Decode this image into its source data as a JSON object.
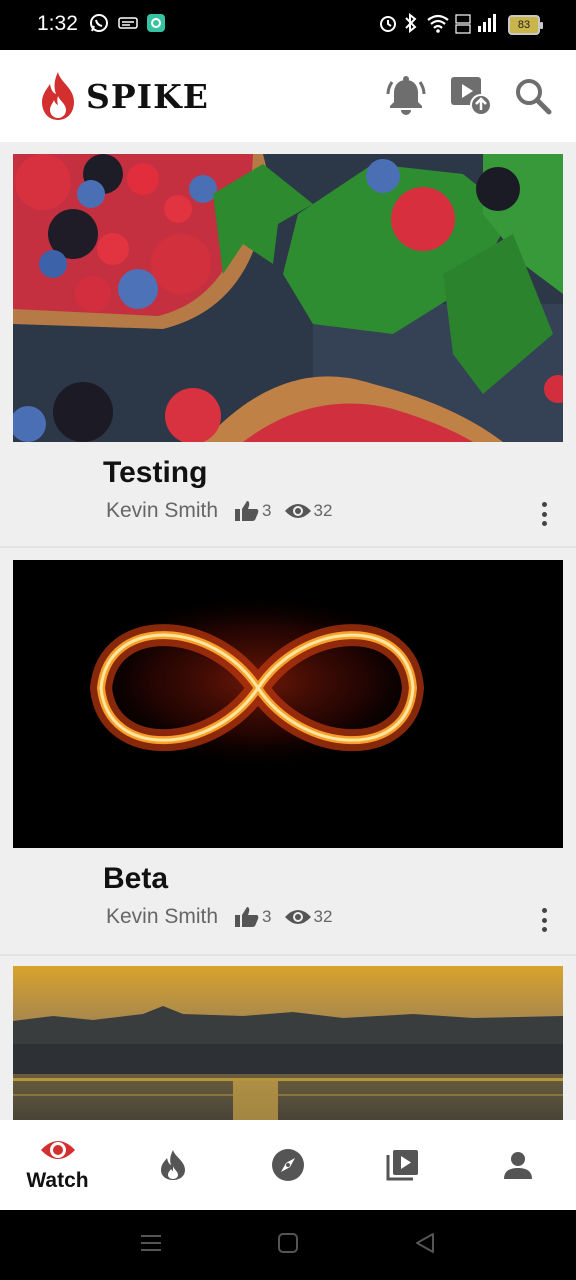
{
  "status_bar": {
    "time": "1:32",
    "battery": "83"
  },
  "app": {
    "brand": "SPIKE",
    "brand_color": "#d32f2f"
  },
  "feed": {
    "videos": [
      {
        "title": "Testing",
        "author": "Kevin Smith",
        "likes": "3",
        "views": "32",
        "thumbnail": "berries-on-dark-table"
      },
      {
        "title": "Beta",
        "author": "Kevin Smith",
        "likes": "3",
        "views": "32",
        "thumbnail": "glowing-infinity-symbol"
      },
      {
        "title": "",
        "author": "",
        "likes": "",
        "views": "",
        "thumbnail": "sunset-over-water"
      }
    ]
  },
  "bottom_nav": {
    "items": [
      {
        "id": "watch",
        "label": "Watch",
        "icon": "eye-icon",
        "active": true
      },
      {
        "id": "trending",
        "label": "",
        "icon": "flame-icon",
        "active": false
      },
      {
        "id": "explore",
        "label": "",
        "icon": "compass-icon",
        "active": false
      },
      {
        "id": "library",
        "label": "",
        "icon": "video-library-icon",
        "active": false
      },
      {
        "id": "profile",
        "label": "",
        "icon": "person-icon",
        "active": false
      }
    ],
    "active_color": "#d32f2f",
    "inactive_color": "#555555"
  },
  "icons": {
    "notifications": "bell-icon",
    "upload": "upload-video-icon",
    "search": "search-icon",
    "like": "thumbs-up-icon",
    "views": "eye-icon",
    "more": "more-vertical-icon"
  }
}
